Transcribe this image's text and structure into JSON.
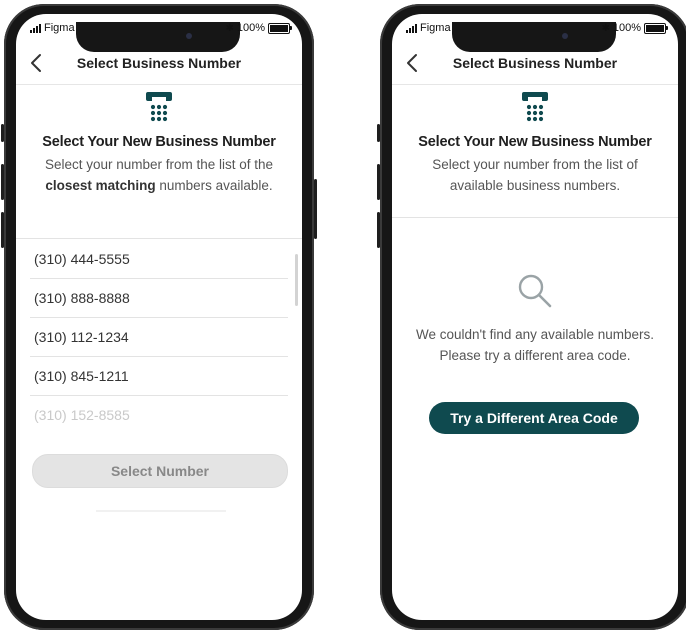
{
  "status": {
    "carrier": "Figma",
    "battery": "100%",
    "battery_level": 1.0
  },
  "left": {
    "nav": {
      "back_icon": "chevron-left-icon",
      "title": "Select Business Number"
    },
    "hero": {
      "icon": "telephone-icon",
      "heading": "Select Your New Business Number",
      "desc_part1": "Select your number from the list of the ",
      "desc_bold": "closest matching",
      "desc_part2": " numbers available."
    },
    "numbers": [
      "(310) 444-5555",
      "(310) 888-8888",
      "(310) 112-1234",
      "(310) 845-1211",
      "(310) 152-8585"
    ],
    "select_button": "Select Number"
  },
  "right": {
    "nav": {
      "back_icon": "chevron-left-icon",
      "title": "Select Business Number"
    },
    "hero": {
      "icon": "telephone-icon",
      "heading": "Select Your New Business Number",
      "desc": "Select your number from the list of available business numbers."
    },
    "empty": {
      "icon": "search-icon",
      "message": "We couldn't find any available numbers. Please try a different area code."
    },
    "cta_button": "Try a Different Area Code"
  },
  "colors": {
    "primary": "#0f4a4f",
    "disabled_button": "#e4e4e4"
  }
}
